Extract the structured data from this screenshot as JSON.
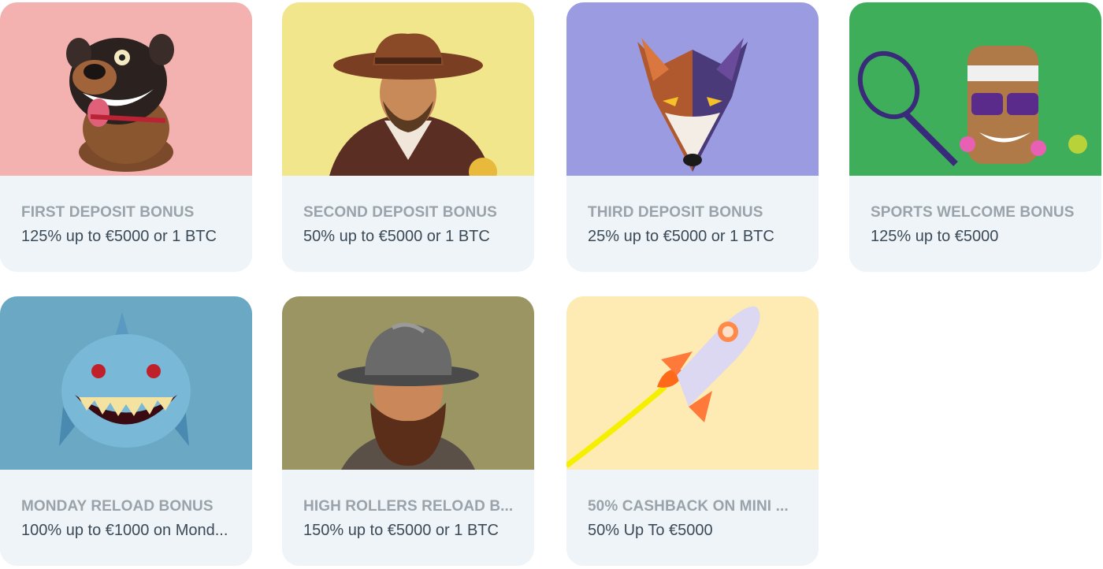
{
  "bonuses": [
    {
      "title": "FIRST DEPOSIT BONUS",
      "description": "125% up to €5000 or 1 BTC",
      "bg_color": "#f3b1af",
      "icon": "bulldog-icon"
    },
    {
      "title": "SECOND DEPOSIT BONUS",
      "description": "50% up to €5000 or 1 BTC",
      "bg_color": "#f1e68c",
      "icon": "cowboy-icon"
    },
    {
      "title": "THIRD DEPOSIT BONUS",
      "description": "25% up to €5000 or 1 BTC",
      "bg_color": "#9a9be0",
      "icon": "wolf-icon"
    },
    {
      "title": "SPORTS WELCOME BONUS",
      "description": "125% up to €5000",
      "bg_color": "#3fae5a",
      "icon": "tiki-tennis-icon"
    },
    {
      "title": "MONDAY RELOAD BONUS",
      "description": "100% up to €1000 on Mond...",
      "bg_color": "#6aa8c4",
      "icon": "shark-icon"
    },
    {
      "title": "HIGH ROLLERS RELOAD B...",
      "description": "150% up to €5000 or 1 BTC",
      "bg_color": "#9a9562",
      "icon": "explorer-icon"
    },
    {
      "title": "50% CASHBACK ON MINI ...",
      "description": "50% Up To €5000",
      "bg_color": "#fdebb3",
      "icon": "rocket-icon"
    }
  ]
}
